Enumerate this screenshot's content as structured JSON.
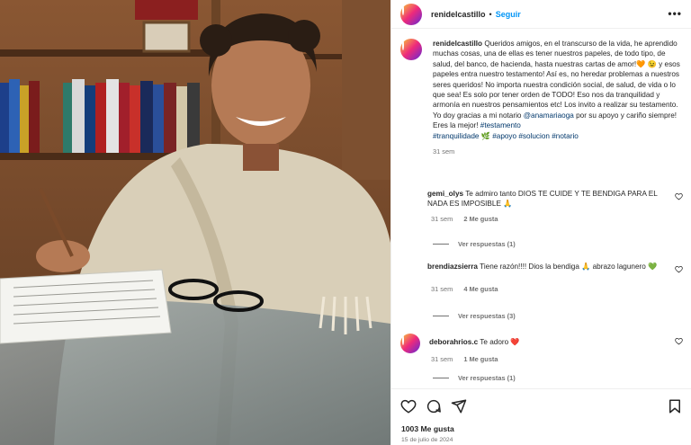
{
  "post": {
    "author": "renidelcastillo",
    "follow_label": "Seguir",
    "more_label": "•••",
    "separator": "•"
  },
  "caption": {
    "username": "renidelcastillo",
    "text_1": "Queridos amigos, en el transcurso de la vida, he aprendido muchas cosas, una de ellas es tener nuestros papeles, de todo tipo, de salud, del banco, de hacienda, hasta nuestras cartas de amor!🧡 😉 y esos papeles entra nuestro testamento! Así es, no heredar problemas a nuestros seres queridos! No importa nuestra condición social, de salud, de vida o lo que sea! Es solo por tener orden de TODO! Eso nos da tranquilidad y armonía en nuestros pensamientos etc! Los invito a realizar su testamento. Yo doy gracias a mi notario ",
    "mention": "@anamariaoga",
    "text_2": " por su apoyo y cariño siempre! Eres la mejor! ",
    "hashtags_1": "#testamento",
    "hashtags_2": "#tranquilidade",
    "emoji_leaf": "🌿",
    "hashtags_3": "#apoyo #solucion #notario",
    "time": "31 sem"
  },
  "comments": [
    {
      "username": "gemi_olys",
      "text": "Te admiro tanto DIOS TE CUIDE Y TE BENDIGA PARA EL NADA ES IMPOSIBLE 🙏",
      "time": "31 sem",
      "likes": "2 Me gusta",
      "replies": "Ver respuestas (1)"
    },
    {
      "username": "brendiazsierra",
      "text": "Tiene razón!!!! Dios la bendiga 🙏 abrazo lagunero 💚",
      "time": "31 sem",
      "likes": "4 Me gusta",
      "replies": "Ver respuestas (3)"
    },
    {
      "username": "deborahrios.c",
      "text": "Te adoro ❤️",
      "time": "31 sem",
      "likes": "1 Me gusta",
      "replies": "Ver respuestas (1)"
    }
  ],
  "footer": {
    "likes": "1003 Me gusta",
    "date": "15 de julio de 2024"
  },
  "icons": {
    "like": "heart-icon",
    "comment": "comment-icon",
    "share": "share-icon",
    "save": "bookmark-icon"
  }
}
